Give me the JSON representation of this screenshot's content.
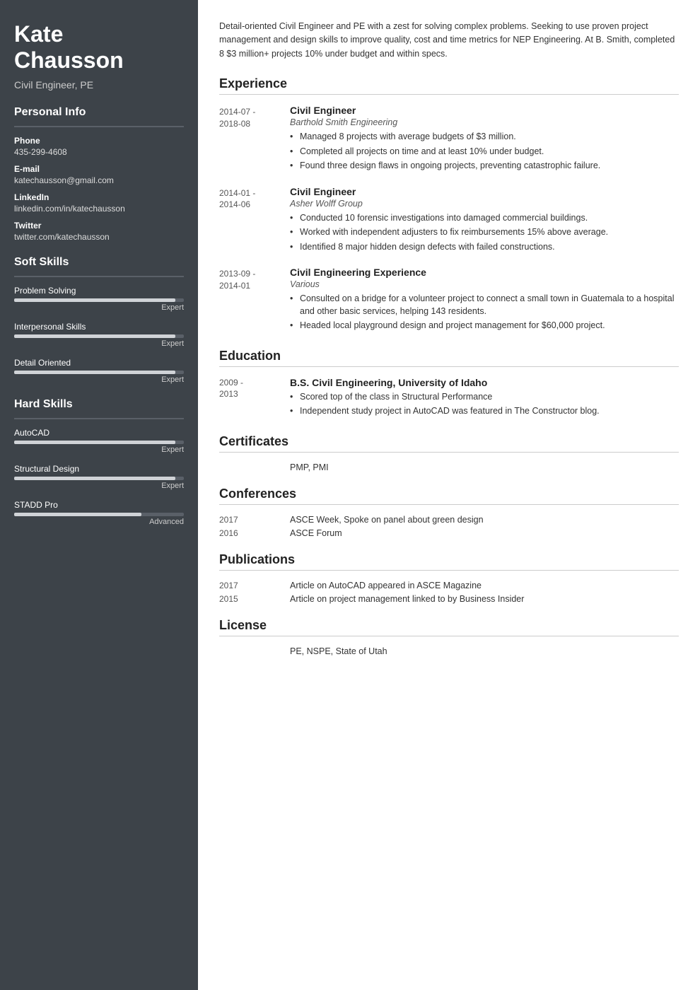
{
  "sidebar": {
    "name": "Kate\nChausson",
    "name_line1": "Kate",
    "name_line2": "Chausson",
    "title": "Civil Engineer, PE",
    "personal_info_label": "Personal Info",
    "phone_label": "Phone",
    "phone_value": "435-299-4608",
    "email_label": "E-mail",
    "email_value": "katechausson@gmail.com",
    "linkedin_label": "LinkedIn",
    "linkedin_value": "linkedin.com/in/katechausson",
    "twitter_label": "Twitter",
    "twitter_value": "twitter.com/katechausson",
    "soft_skills_label": "Soft Skills",
    "soft_skills": [
      {
        "name": "Problem Solving",
        "level_label": "Expert",
        "fill_pct": 95
      },
      {
        "name": "Interpersonal Skills",
        "level_label": "Expert",
        "fill_pct": 95
      },
      {
        "name": "Detail Oriented",
        "level_label": "Expert",
        "fill_pct": 95
      }
    ],
    "hard_skills_label": "Hard Skills",
    "hard_skills": [
      {
        "name": "AutoCAD",
        "level_label": "Expert",
        "fill_pct": 95
      },
      {
        "name": "Structural Design",
        "level_label": "Expert",
        "fill_pct": 95
      },
      {
        "name": "STADD Pro",
        "level_label": "Advanced",
        "fill_pct": 75
      }
    ]
  },
  "main": {
    "summary": "Detail-oriented Civil Engineer and PE with a zest for solving complex problems. Seeking to use proven project management and design skills to improve quality, cost and time metrics for NEP Engineering. At B. Smith, completed 8 $3 million+ projects 10% under budget and within specs.",
    "experience_label": "Experience",
    "experiences": [
      {
        "date": "2014-07 -\n2018-08",
        "job_title": "Civil Engineer",
        "company": "Barthold Smith Engineering",
        "bullets": [
          "Managed 8 projects with average budgets of $3 million.",
          "Completed all projects on time and at least 10% under budget.",
          "Found three design flaws in ongoing projects, preventing catastrophic failure."
        ]
      },
      {
        "date": "2014-01 -\n2014-06",
        "job_title": "Civil Engineer",
        "company": "Asher Wolff Group",
        "bullets": [
          "Conducted 10 forensic investigations into damaged commercial buildings.",
          "Worked with independent adjusters to fix reimbursements 15% above average.",
          "Identified 8 major hidden design defects with failed constructions."
        ]
      },
      {
        "date": "2013-09 -\n2014-01",
        "job_title": "Civil Engineering Experience",
        "company": "Various",
        "bullets": [
          "Consulted on a bridge for a volunteer project to connect a small town in Guatemala to a hospital and other basic services, helping 143 residents.",
          "Headed local playground design and project management for $60,000 project."
        ]
      }
    ],
    "education_label": "Education",
    "educations": [
      {
        "date": "2009 -\n2013",
        "degree": "B.S. Civil Engineering, University of Idaho",
        "bullets": [
          "Scored top of the class in Structural Performance",
          "Independent study project in AutoCAD was featured in The Constructor blog."
        ]
      }
    ],
    "certificates_label": "Certificates",
    "certificates_value": "PMP, PMI",
    "conferences_label": "Conferences",
    "conferences": [
      {
        "year": "2017",
        "desc": "ASCE Week, Spoke on panel about green design"
      },
      {
        "year": "2016",
        "desc": "ASCE Forum"
      }
    ],
    "publications_label": "Publications",
    "publications": [
      {
        "year": "2017",
        "desc": "Article on AutoCAD appeared in ASCE Magazine"
      },
      {
        "year": "2015",
        "desc": "Article on project management linked to by Business Insider"
      }
    ],
    "license_label": "License",
    "license_value": "PE, NSPE, State of Utah"
  }
}
